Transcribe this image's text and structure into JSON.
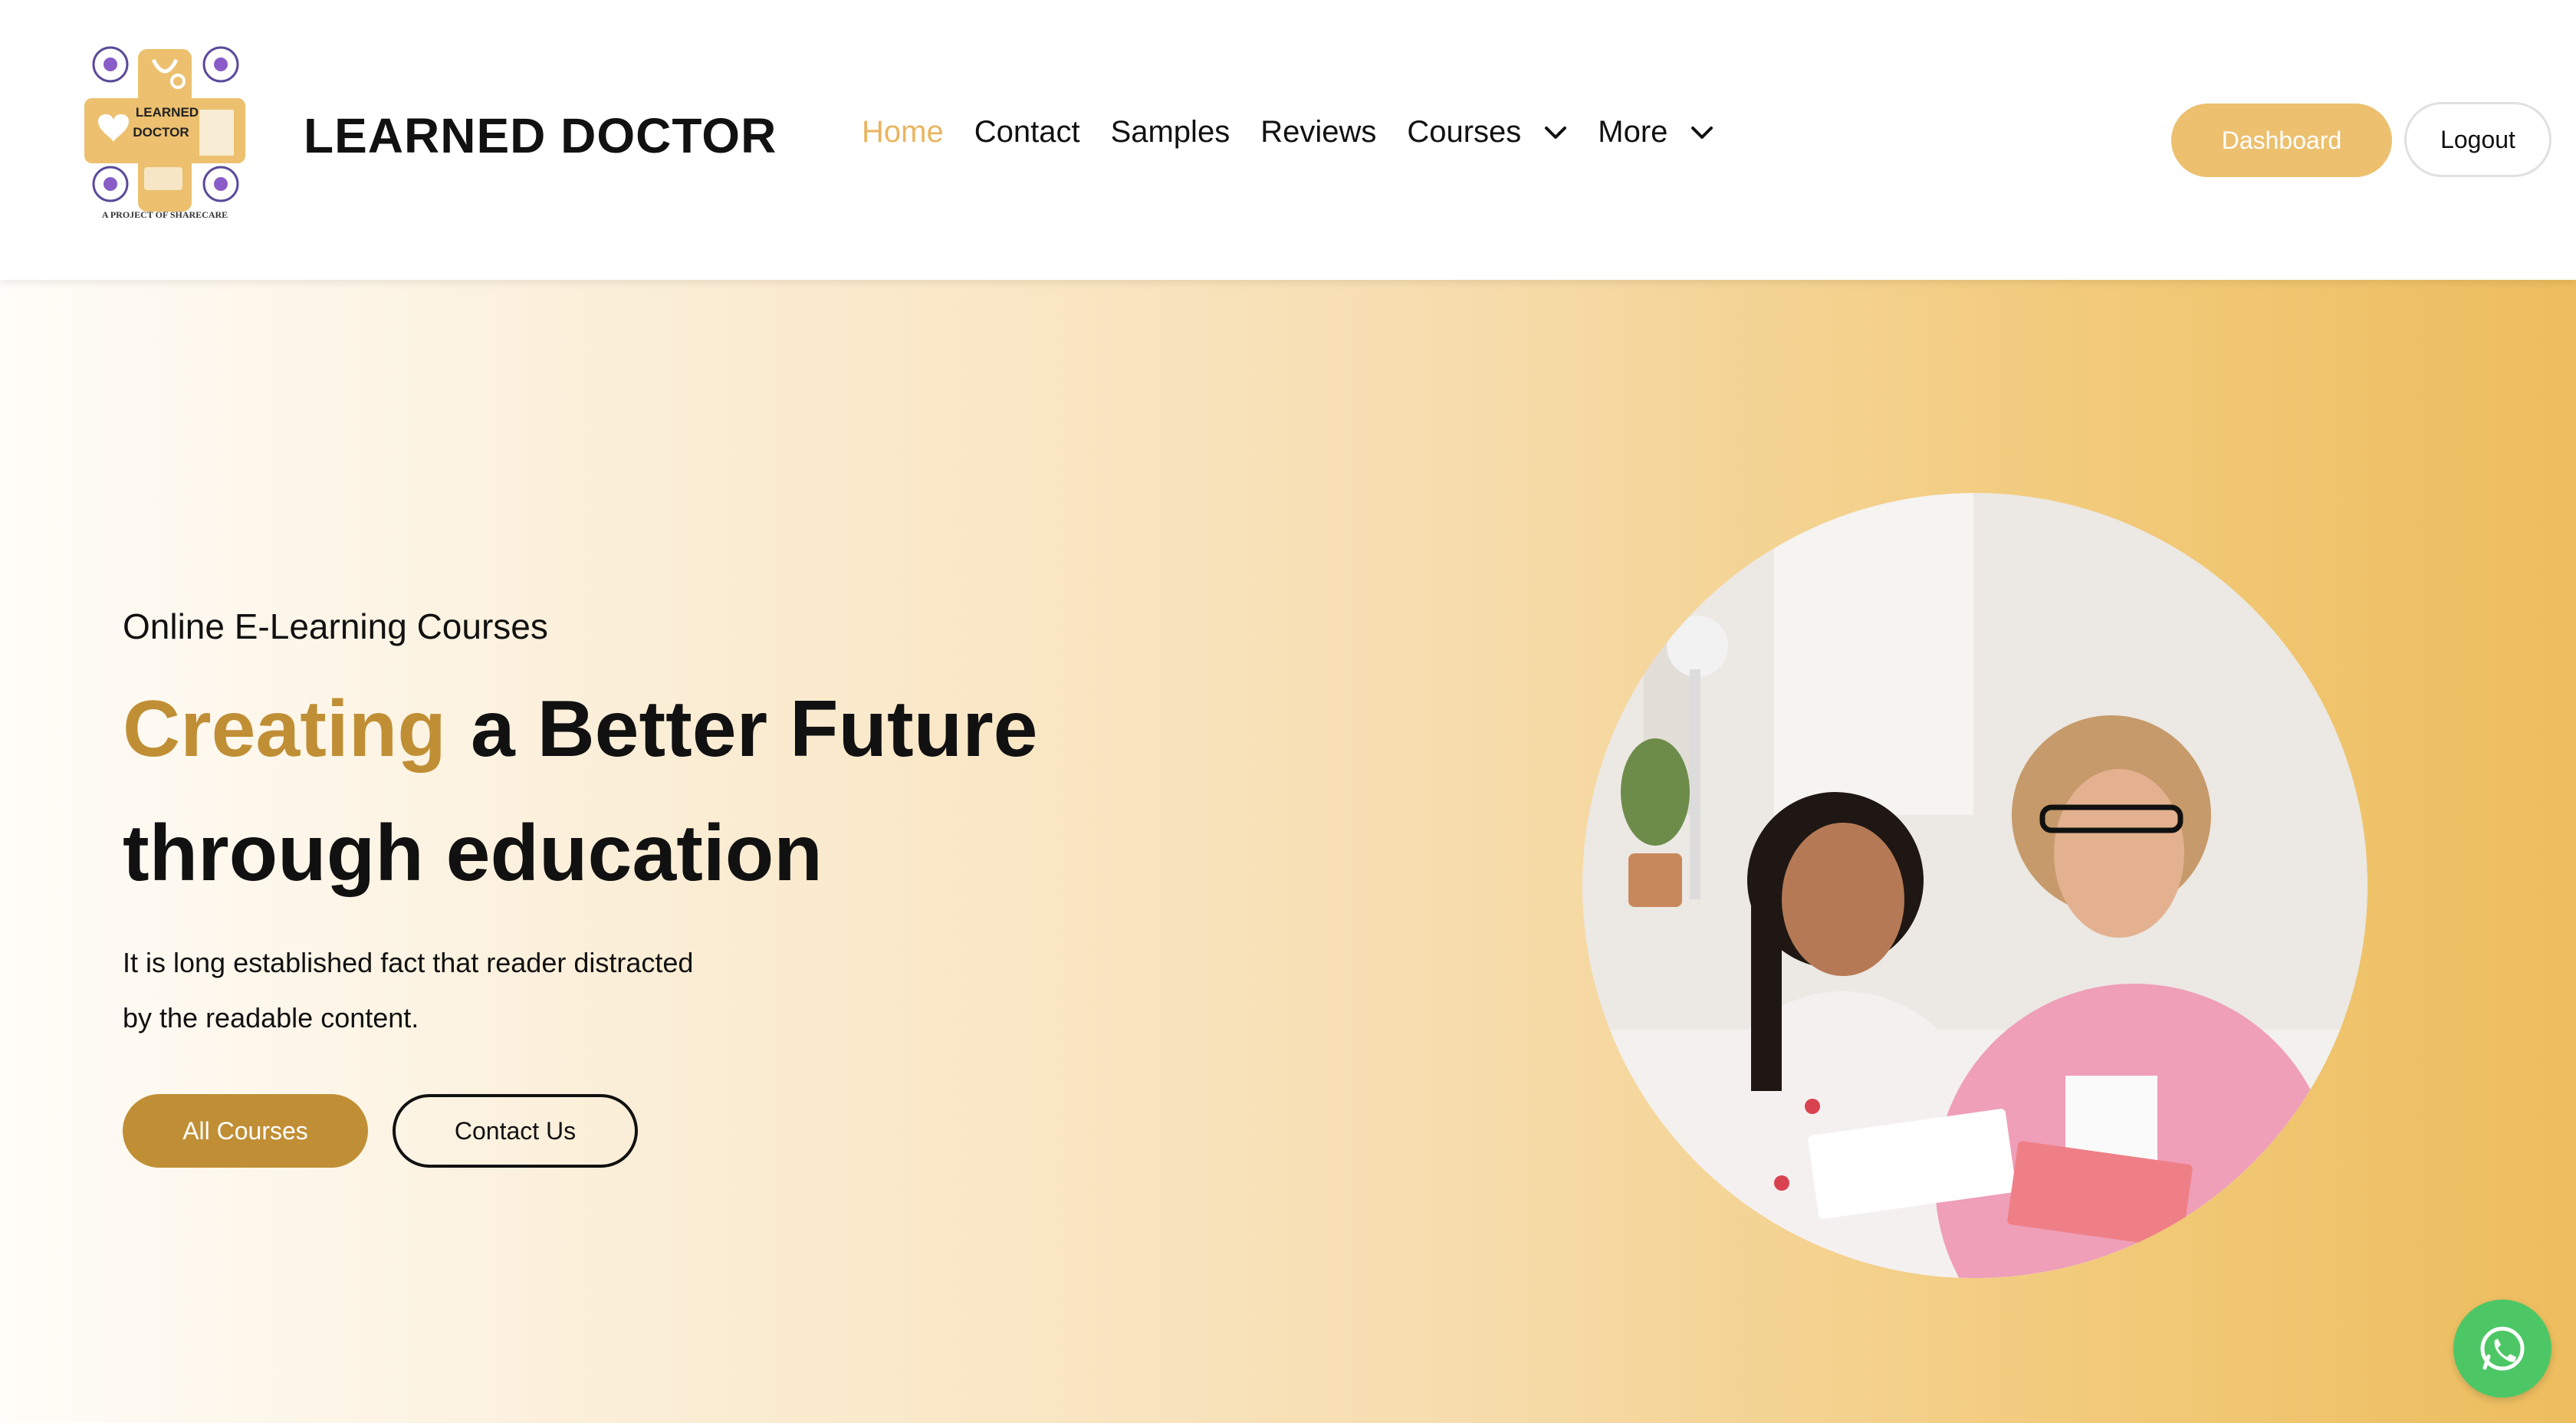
{
  "brand": {
    "name": "LEARNED DOCTOR",
    "logo_text_line1": "LEARNED",
    "logo_text_line2": "DOCTOR",
    "logo_tagline": "A PROJECT OF SHARECARE"
  },
  "nav": {
    "items": [
      {
        "label": "Home",
        "active": true
      },
      {
        "label": "Contact"
      },
      {
        "label": "Samples"
      },
      {
        "label": "Reviews"
      },
      {
        "label": "Courses",
        "dropdown": true
      },
      {
        "label": "More",
        "dropdown": true
      }
    ]
  },
  "header_actions": {
    "dashboard_label": "Dashboard",
    "logout_label": "Logout"
  },
  "hero": {
    "eyebrow": "Online E-Learning Courses",
    "headline_accent": "Creating",
    "headline_rest_line1": "a Better Future",
    "headline_line2": "through education",
    "description_line1": "It is long established fact that reader distracted",
    "description_line2": "by the readable content.",
    "primary_button": "All Courses",
    "secondary_button": "Contact Us",
    "image_icon": "photo-teacher-student"
  },
  "floating": {
    "icon": "whatsapp-icon"
  },
  "colors": {
    "accent": "#c08f35",
    "accent_light": "#ecc06e",
    "nav_active": "#e8b560",
    "whatsapp": "#4dc766"
  }
}
